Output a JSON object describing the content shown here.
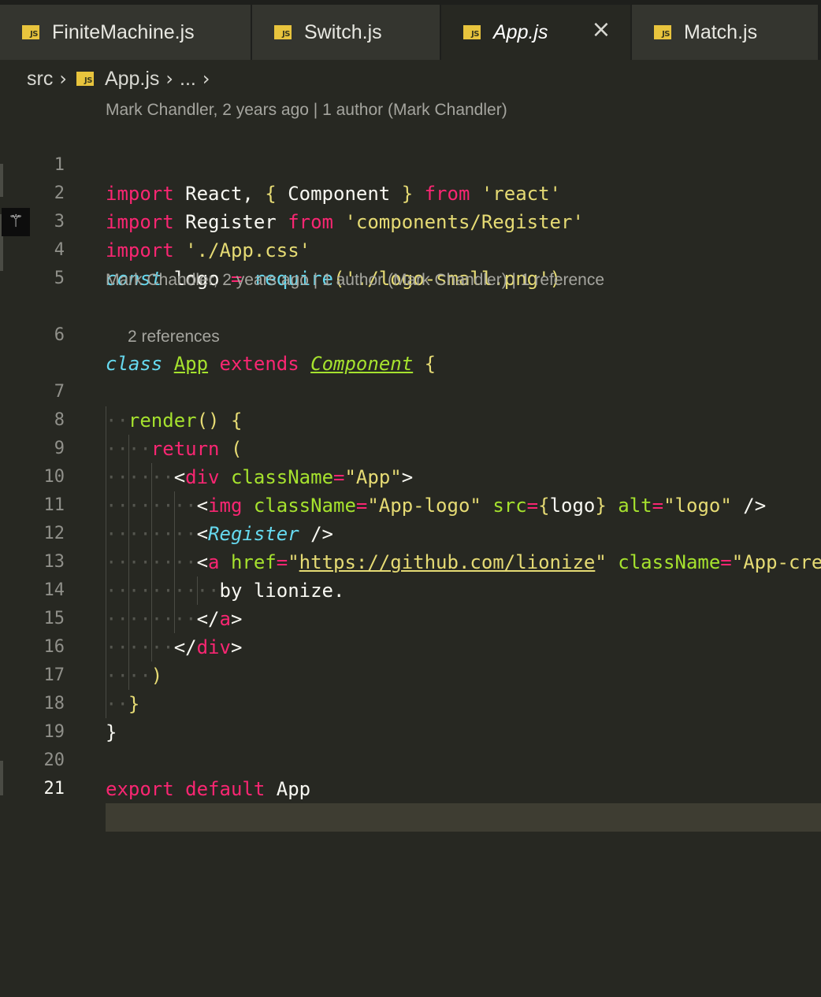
{
  "tabs": [
    {
      "label": "FiniteMachine.js",
      "icon": "JS"
    },
    {
      "label": "Switch.js",
      "icon": "JS"
    },
    {
      "label": "App.js",
      "icon": "JS",
      "active": true
    },
    {
      "label": "Match.js",
      "icon": "JS"
    }
  ],
  "breadcrumb": {
    "folder": "src",
    "file": "App.js",
    "more": "..."
  },
  "codelens": {
    "l1": "Mark Chandler, 2 years ago | 1 author (Mark Chandler)",
    "l6": "Mark Chandler, 2 years ago | 1 author (Mark Chandler) | 1 reference",
    "l7": "2 references"
  },
  "line_numbers": [
    "1",
    "2",
    "3",
    "4",
    "5",
    "6",
    "7",
    "8",
    "9",
    "10",
    "11",
    "12",
    "13",
    "14",
    "15",
    "16",
    "17",
    "18",
    "19",
    "20",
    "21"
  ],
  "code": {
    "l1": {
      "t1": "import",
      "t2": " React, ",
      "t3": "{",
      "t4": " Component ",
      "t5": "}",
      "t6": " from ",
      "t7": "'react'"
    },
    "l2": {
      "t1": "import",
      "t2": " Register ",
      "t3": "from",
      "t4": " ",
      "t5": "'components/Register'"
    },
    "l3": {
      "t1": "import",
      "t2": " ",
      "t3": "'./App.css'"
    },
    "l4": {
      "t1": "const",
      "t2": " logo ",
      "t3": "=",
      "t4": " ",
      "t5": "require",
      "t6": "(",
      "t7": "'./logo-small.png'",
      "t8": ")"
    },
    "l6": {
      "t1": "class",
      "t2": " ",
      "t3": "App",
      "t4": " ",
      "t5": "extends",
      "t6": " ",
      "t7": "Component",
      "t8": " ",
      "t9": "{"
    },
    "l7": {
      "t1": "render",
      "t2": "()",
      "t3": " ",
      "t4": "{"
    },
    "l8": {
      "t1": "return",
      "t2": " ",
      "t3": "("
    },
    "l9": {
      "t1": "<",
      "t2": "div",
      "t3": " ",
      "t4": "className",
      "t5": "=",
      "t6": "\"App\"",
      "t7": ">"
    },
    "l10": {
      "t1": "<",
      "t2": "img",
      "t3": " ",
      "t4": "className",
      "t5": "=",
      "t6": "\"App-logo\"",
      "t7": " ",
      "t8": "src",
      "t9": "=",
      "t10": "{",
      "t11": "logo",
      "t12": "}",
      "t13": " ",
      "t14": "alt",
      "t15": "=",
      "t16": "\"logo\"",
      "t17": " />"
    },
    "l11": {
      "t1": "<",
      "t2": "Register",
      "t3": " />"
    },
    "l12": {
      "t1": "<",
      "t2": "a",
      "t3": " ",
      "t4": "href",
      "t5": "=",
      "t6": "\"",
      "t7": "https://github.com/lionize",
      "t8": "\"",
      "t9": " ",
      "t10": "className",
      "t11": "=",
      "t12": "\"App-cre"
    },
    "l13": {
      "t1": "by lionize."
    },
    "l14": {
      "t1": "</",
      "t2": "a",
      "t3": ">"
    },
    "l15": {
      "t1": "</",
      "t2": "div",
      "t3": ">"
    },
    "l16": {
      "t1": ")"
    },
    "l17": {
      "t1": "}"
    },
    "l18": {
      "t1": "}"
    },
    "l20": {
      "t1": "export",
      "t2": " ",
      "t3": "default",
      "t4": " App"
    }
  },
  "colors": {
    "background": "#272822",
    "keyword": "#f92672",
    "string": "#e6db74",
    "storage": "#66d9ef",
    "function": "#a6e22e"
  }
}
